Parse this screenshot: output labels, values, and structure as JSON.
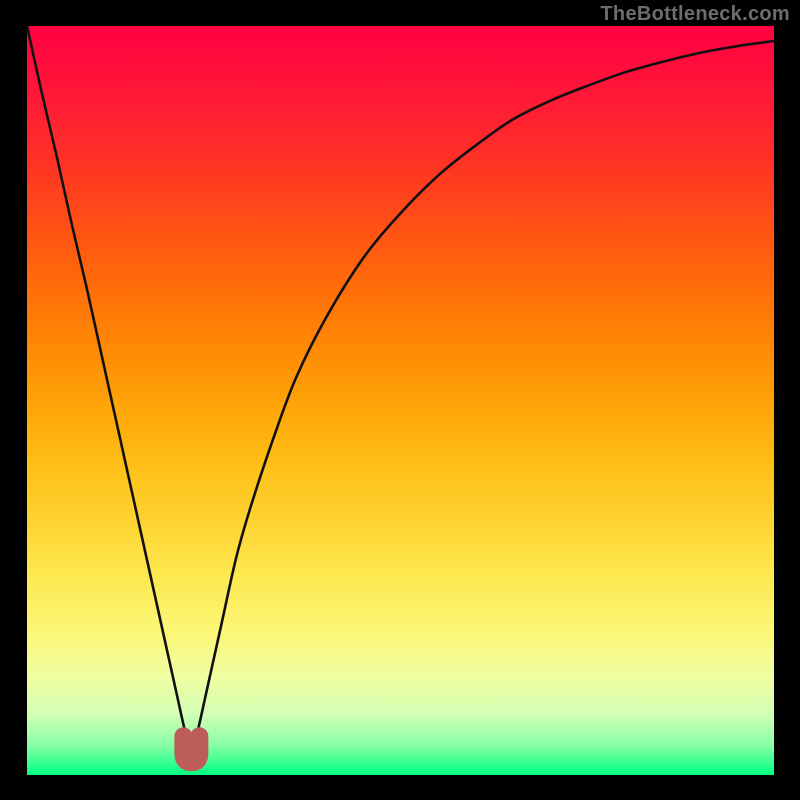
{
  "watermark": "TheBottleneck.com",
  "colors": {
    "background_frame": "#000000",
    "curve_stroke": "#111111",
    "marker_fill": "#bd5d59",
    "gradient_top": "#ff0040",
    "gradient_bottom": "#00ff80"
  },
  "chart_data": {
    "type": "line",
    "title": "",
    "xlabel": "",
    "ylabel": "",
    "xlim": [
      0,
      100
    ],
    "ylim": [
      0,
      100
    ],
    "grid": false,
    "legend": false,
    "annotations": {
      "marker": {
        "shape": "u",
        "x": 22,
        "y": 2.5,
        "color": "#bd5d59"
      }
    },
    "series": [
      {
        "name": "main-curve",
        "x": [
          0,
          2,
          4,
          6,
          8,
          10,
          12,
          14,
          16,
          18,
          20,
          21,
          22,
          23,
          24,
          26,
          28,
          30,
          33,
          36,
          40,
          45,
          50,
          55,
          60,
          65,
          70,
          75,
          80,
          85,
          90,
          95,
          100
        ],
        "y": [
          100,
          91,
          82.5,
          73.5,
          65,
          56,
          47,
          38,
          29,
          20,
          11,
          6.5,
          2.5,
          6.5,
          11,
          20,
          29,
          36,
          45,
          53,
          61,
          69,
          75,
          80,
          84,
          87.5,
          90,
          92,
          93.8,
          95.2,
          96.4,
          97.3,
          98
        ]
      }
    ]
  }
}
